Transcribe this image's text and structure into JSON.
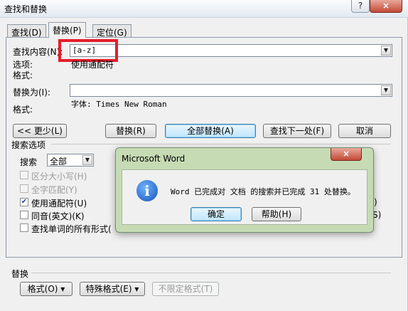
{
  "window": {
    "title": "查找和替换",
    "help": "?",
    "close": "×"
  },
  "tabs": [
    {
      "label": "查找(D)"
    },
    {
      "label": "替换(P)"
    },
    {
      "label": "定位(G)"
    }
  ],
  "find": {
    "label": "查找内容(N):",
    "value": "[a-z]",
    "options_label": "选项:",
    "options_value": "使用通配符",
    "format_label": "格式:"
  },
  "replace": {
    "label": "替换为(I):",
    "value": "",
    "format_label": "格式:",
    "format_value": "字体: Times New Roman"
  },
  "buttons": {
    "less": "<< 更少(L)",
    "replace": "替换(R)",
    "replace_all": "全部替换(A)",
    "find_next": "查找下一处(F)",
    "cancel": "取消"
  },
  "search_options": {
    "title": "搜索选项",
    "search_label": "搜索",
    "search_value": "全部",
    "match_case": "区分大小写(H)",
    "whole_word": "全字匹配(Y)",
    "wildcards": "使用通配符(U)",
    "sounds_like": "同音(英文)(K)",
    "word_forms": "查找单词的所有形式(",
    "right_partial_1": ")",
    "right_partial_2": "S)"
  },
  "replace_section": {
    "title": "替换",
    "format_btn": "格式(O) ▾",
    "special_btn": "特殊格式(E) ▾",
    "no_format_btn": "不限定格式(T)"
  },
  "message_box": {
    "title": "Microsoft Word",
    "close": "×",
    "icon": "info-icon",
    "message": "Word 已完成对 文档 的搜索并已完成 31 处替换。",
    "ok": "确定",
    "help": "帮助(H)"
  }
}
